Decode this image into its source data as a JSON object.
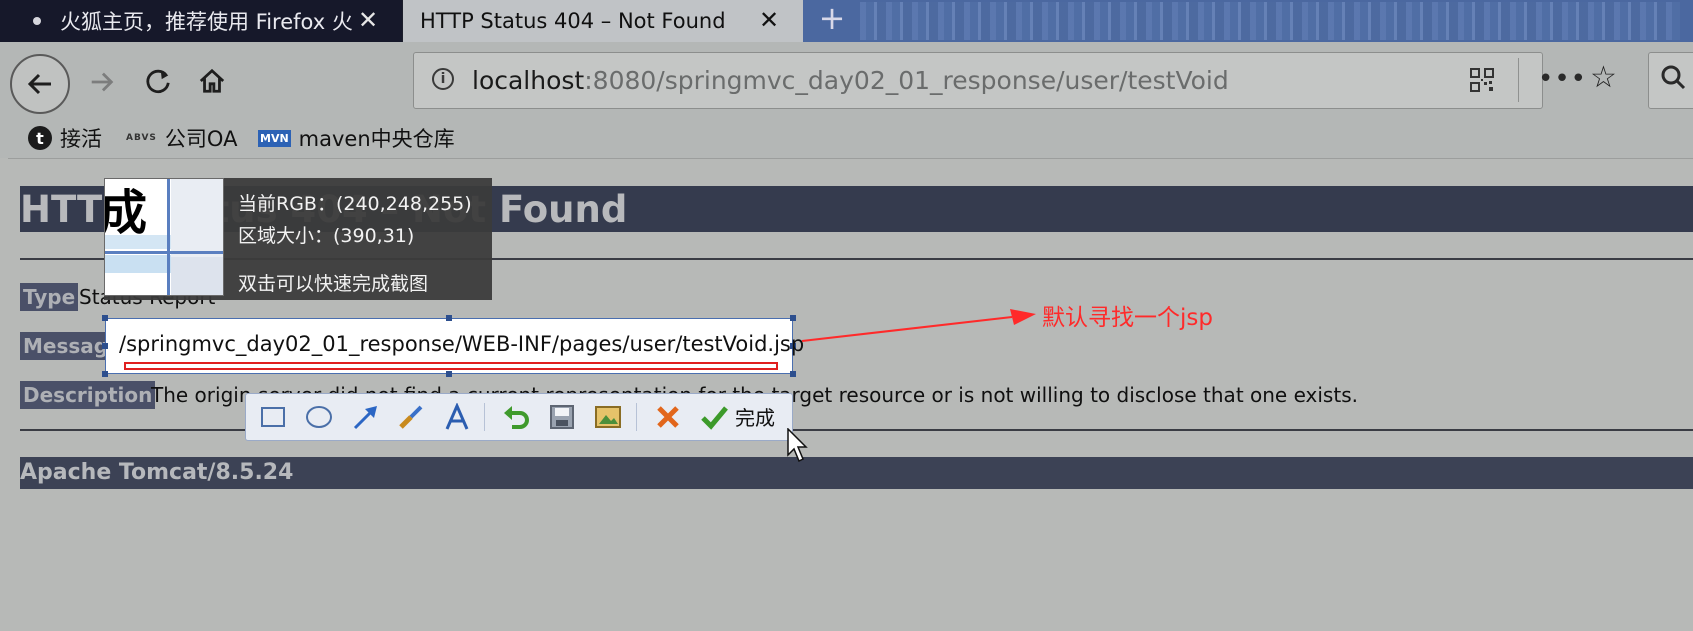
{
  "tabs": [
    {
      "title": "火狐主页，推荐使用 Firefox 火",
      "close": "✕"
    },
    {
      "title": "HTTP Status 404 – Not Found",
      "close": "✕"
    }
  ],
  "new_tab": "+",
  "address": {
    "host": "localhost",
    "rest": ":8080/springmvc_day02_01_response/user/testVoid"
  },
  "bookmarks": [
    {
      "label": "接活",
      "icon": "t"
    },
    {
      "label": "公司OA",
      "icon": "ABVS"
    },
    {
      "label": "maven中央仓库",
      "icon": "MVN"
    }
  ],
  "page": {
    "heading": "HTTP Status 404 – Not Found",
    "type_label": "Type",
    "type_value": "Status Report",
    "message_label": "Message",
    "description_label": "Description",
    "description_value": "The origin server did not find a current representation for the target resource or is not willing to disclose that one exists.",
    "footer": "Apache Tomcat/8.5.24"
  },
  "capture": {
    "selected_text": "/springmvc_day02_01_response/WEB-INF/pages/user/testVoid.jsp",
    "zoom_char": "成",
    "rgb_line": "当前RGB：(240,248,255)",
    "size_line": "区域大小：(390,31)",
    "hint_line": "双击可以快速完成截图",
    "annotation": "默认寻找一个jsp",
    "done_label": "完成"
  },
  "colors": {
    "annotation": "#ff2a2a",
    "heading_bar": "#353b4e"
  }
}
